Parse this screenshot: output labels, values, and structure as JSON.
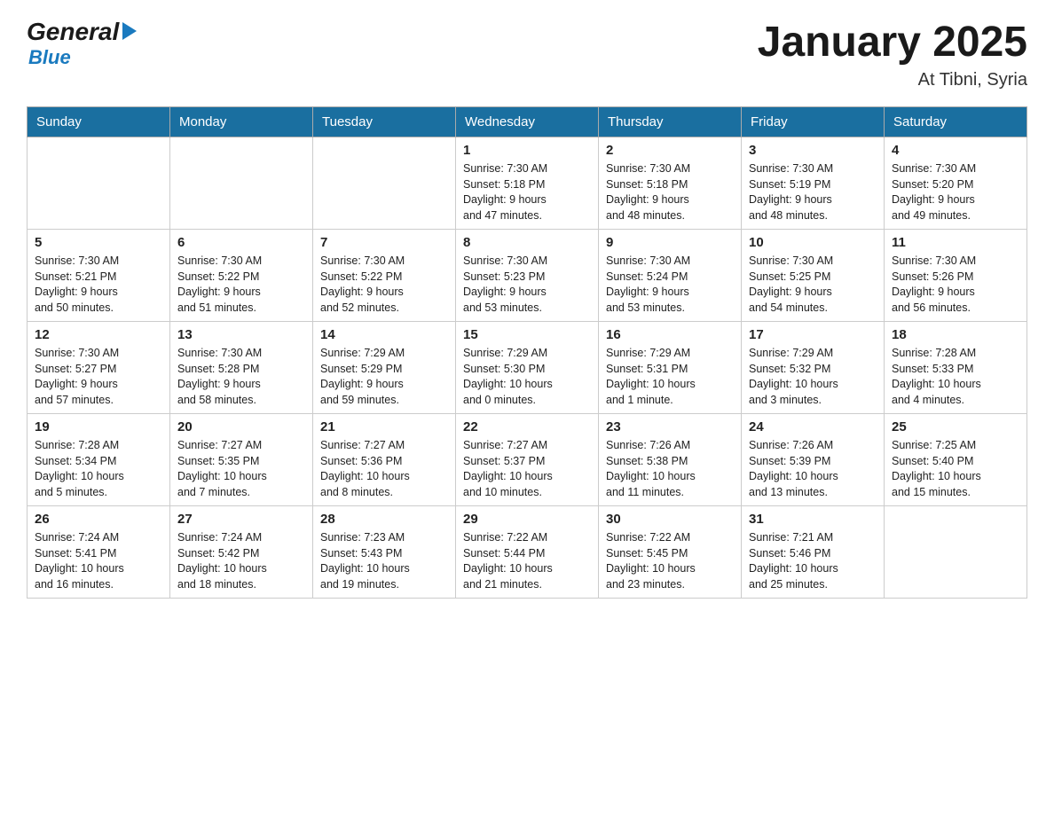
{
  "header": {
    "logo": {
      "general": "General",
      "arrow": "▶",
      "blue": "Blue"
    },
    "title": "January 2025",
    "subtitle": "At Tibni, Syria"
  },
  "days_of_week": [
    "Sunday",
    "Monday",
    "Tuesday",
    "Wednesday",
    "Thursday",
    "Friday",
    "Saturday"
  ],
  "weeks": [
    [
      {
        "day": "",
        "info": ""
      },
      {
        "day": "",
        "info": ""
      },
      {
        "day": "",
        "info": ""
      },
      {
        "day": "1",
        "info": "Sunrise: 7:30 AM\nSunset: 5:18 PM\nDaylight: 9 hours\nand 47 minutes."
      },
      {
        "day": "2",
        "info": "Sunrise: 7:30 AM\nSunset: 5:18 PM\nDaylight: 9 hours\nand 48 minutes."
      },
      {
        "day": "3",
        "info": "Sunrise: 7:30 AM\nSunset: 5:19 PM\nDaylight: 9 hours\nand 48 minutes."
      },
      {
        "day": "4",
        "info": "Sunrise: 7:30 AM\nSunset: 5:20 PM\nDaylight: 9 hours\nand 49 minutes."
      }
    ],
    [
      {
        "day": "5",
        "info": "Sunrise: 7:30 AM\nSunset: 5:21 PM\nDaylight: 9 hours\nand 50 minutes."
      },
      {
        "day": "6",
        "info": "Sunrise: 7:30 AM\nSunset: 5:22 PM\nDaylight: 9 hours\nand 51 minutes."
      },
      {
        "day": "7",
        "info": "Sunrise: 7:30 AM\nSunset: 5:22 PM\nDaylight: 9 hours\nand 52 minutes."
      },
      {
        "day": "8",
        "info": "Sunrise: 7:30 AM\nSunset: 5:23 PM\nDaylight: 9 hours\nand 53 minutes."
      },
      {
        "day": "9",
        "info": "Sunrise: 7:30 AM\nSunset: 5:24 PM\nDaylight: 9 hours\nand 53 minutes."
      },
      {
        "day": "10",
        "info": "Sunrise: 7:30 AM\nSunset: 5:25 PM\nDaylight: 9 hours\nand 54 minutes."
      },
      {
        "day": "11",
        "info": "Sunrise: 7:30 AM\nSunset: 5:26 PM\nDaylight: 9 hours\nand 56 minutes."
      }
    ],
    [
      {
        "day": "12",
        "info": "Sunrise: 7:30 AM\nSunset: 5:27 PM\nDaylight: 9 hours\nand 57 minutes."
      },
      {
        "day": "13",
        "info": "Sunrise: 7:30 AM\nSunset: 5:28 PM\nDaylight: 9 hours\nand 58 minutes."
      },
      {
        "day": "14",
        "info": "Sunrise: 7:29 AM\nSunset: 5:29 PM\nDaylight: 9 hours\nand 59 minutes."
      },
      {
        "day": "15",
        "info": "Sunrise: 7:29 AM\nSunset: 5:30 PM\nDaylight: 10 hours\nand 0 minutes."
      },
      {
        "day": "16",
        "info": "Sunrise: 7:29 AM\nSunset: 5:31 PM\nDaylight: 10 hours\nand 1 minute."
      },
      {
        "day": "17",
        "info": "Sunrise: 7:29 AM\nSunset: 5:32 PM\nDaylight: 10 hours\nand 3 minutes."
      },
      {
        "day": "18",
        "info": "Sunrise: 7:28 AM\nSunset: 5:33 PM\nDaylight: 10 hours\nand 4 minutes."
      }
    ],
    [
      {
        "day": "19",
        "info": "Sunrise: 7:28 AM\nSunset: 5:34 PM\nDaylight: 10 hours\nand 5 minutes."
      },
      {
        "day": "20",
        "info": "Sunrise: 7:27 AM\nSunset: 5:35 PM\nDaylight: 10 hours\nand 7 minutes."
      },
      {
        "day": "21",
        "info": "Sunrise: 7:27 AM\nSunset: 5:36 PM\nDaylight: 10 hours\nand 8 minutes."
      },
      {
        "day": "22",
        "info": "Sunrise: 7:27 AM\nSunset: 5:37 PM\nDaylight: 10 hours\nand 10 minutes."
      },
      {
        "day": "23",
        "info": "Sunrise: 7:26 AM\nSunset: 5:38 PM\nDaylight: 10 hours\nand 11 minutes."
      },
      {
        "day": "24",
        "info": "Sunrise: 7:26 AM\nSunset: 5:39 PM\nDaylight: 10 hours\nand 13 minutes."
      },
      {
        "day": "25",
        "info": "Sunrise: 7:25 AM\nSunset: 5:40 PM\nDaylight: 10 hours\nand 15 minutes."
      }
    ],
    [
      {
        "day": "26",
        "info": "Sunrise: 7:24 AM\nSunset: 5:41 PM\nDaylight: 10 hours\nand 16 minutes."
      },
      {
        "day": "27",
        "info": "Sunrise: 7:24 AM\nSunset: 5:42 PM\nDaylight: 10 hours\nand 18 minutes."
      },
      {
        "day": "28",
        "info": "Sunrise: 7:23 AM\nSunset: 5:43 PM\nDaylight: 10 hours\nand 19 minutes."
      },
      {
        "day": "29",
        "info": "Sunrise: 7:22 AM\nSunset: 5:44 PM\nDaylight: 10 hours\nand 21 minutes."
      },
      {
        "day": "30",
        "info": "Sunrise: 7:22 AM\nSunset: 5:45 PM\nDaylight: 10 hours\nand 23 minutes."
      },
      {
        "day": "31",
        "info": "Sunrise: 7:21 AM\nSunset: 5:46 PM\nDaylight: 10 hours\nand 25 minutes."
      },
      {
        "day": "",
        "info": ""
      }
    ]
  ]
}
